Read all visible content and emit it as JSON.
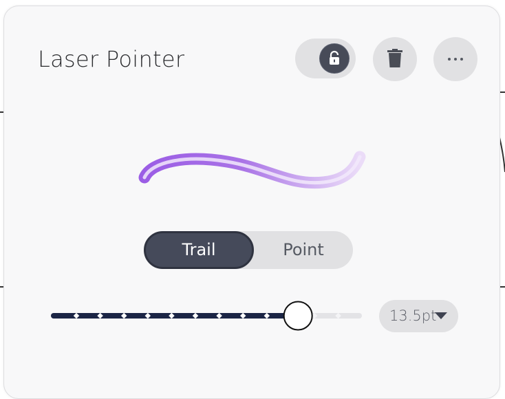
{
  "panel": {
    "title": "Laser Pointer"
  },
  "header": {
    "lock_toggle": {
      "icon": "lock-icon",
      "state": "locked"
    },
    "trash_button": {
      "icon": "trash-icon"
    },
    "more_button": {
      "icon": "more-horizontal-icon"
    }
  },
  "preview": {
    "icon": "laser-stroke-preview",
    "colors": {
      "main": "#9b5de5",
      "inner": "#e7d8f7"
    }
  },
  "mode": {
    "options": [
      {
        "label": "Trail",
        "selected": true
      },
      {
        "label": "Point",
        "selected": false
      }
    ]
  },
  "size": {
    "value_label": "13.5pt",
    "slider_level": 0.8,
    "tick_count": 12
  },
  "colors": {
    "panel_bg": "#f8f8f9",
    "control_bg": "#e1e1e3",
    "accent_dark": "#454a5a",
    "slider_track": "#1b2545"
  }
}
